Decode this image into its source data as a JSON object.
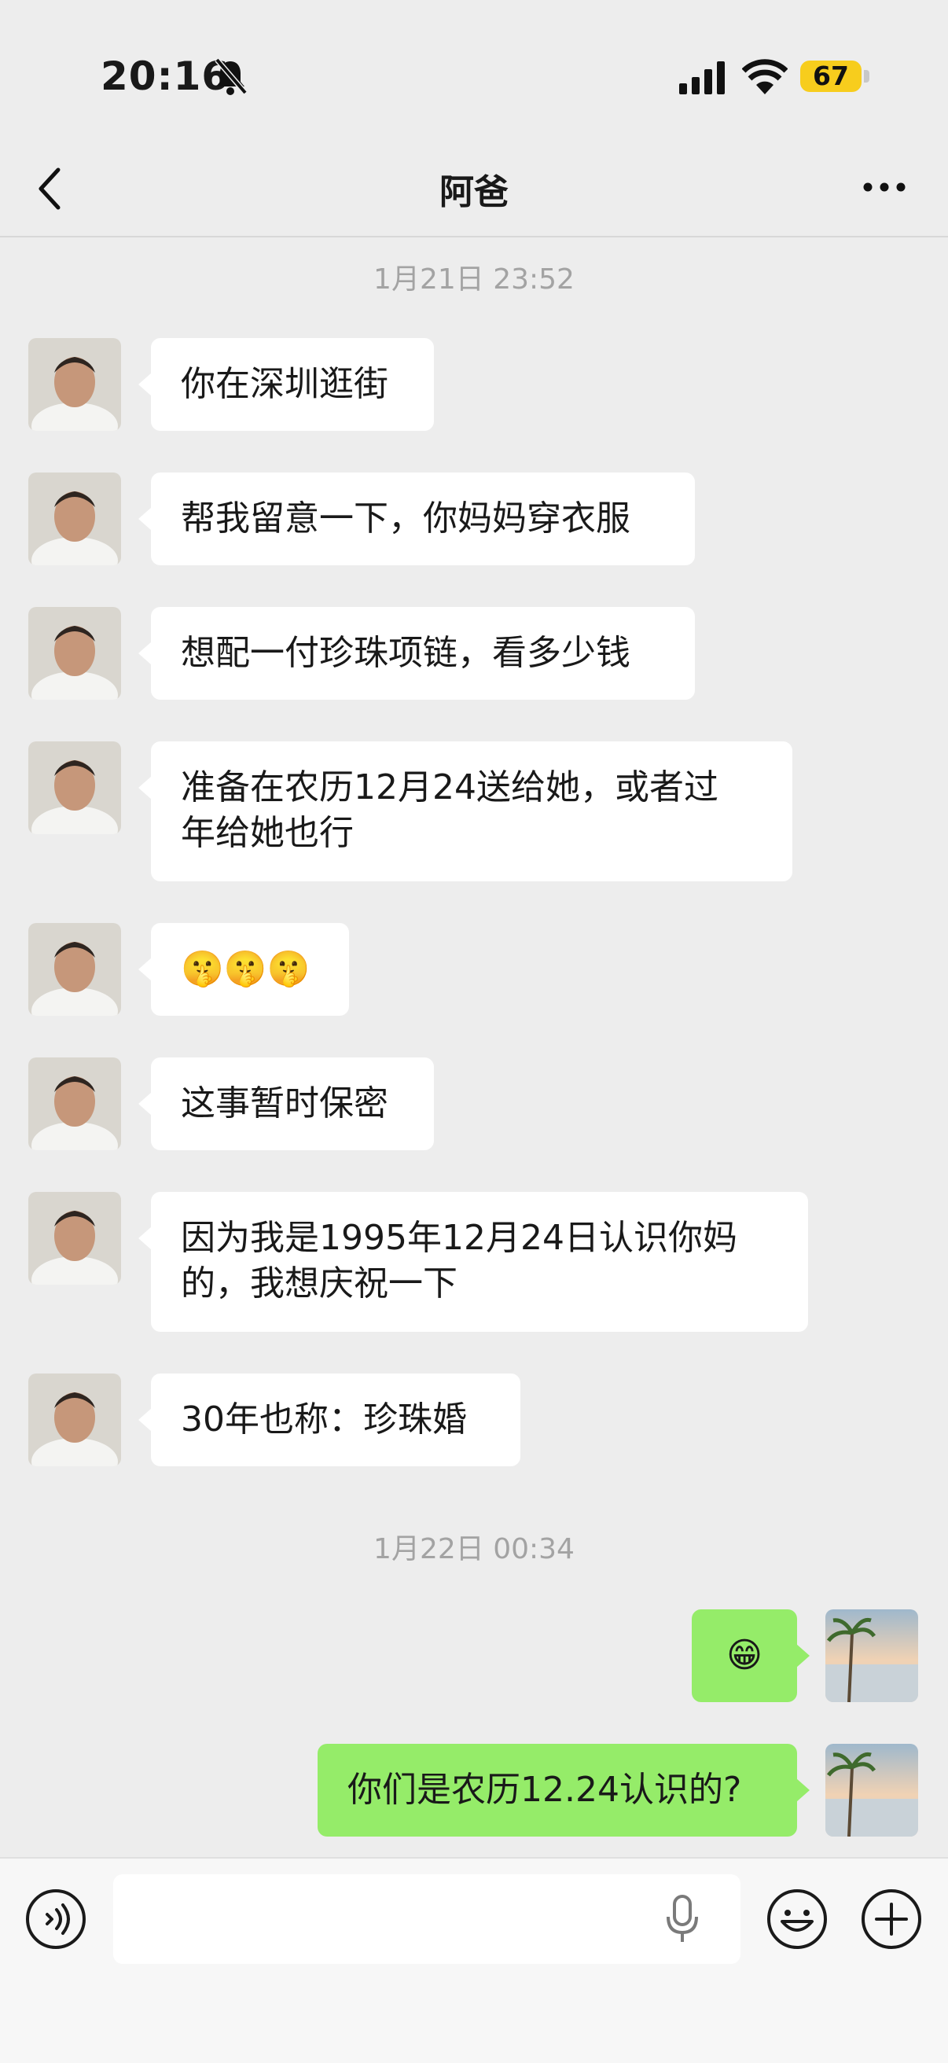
{
  "status_bar": {
    "time": "20:16",
    "battery": "67",
    "icons": [
      "bell-slash-icon",
      "signal-icon",
      "wifi-icon",
      "battery-icon"
    ]
  },
  "nav": {
    "title": "阿爸",
    "back_icon": "chevron-left-icon",
    "more_icon": "more-dots-icon"
  },
  "timestamps": [
    "1月21日 23:52",
    "1月22日 00:34"
  ],
  "messages": [
    {
      "from": "dad",
      "text": "你在深圳逛街"
    },
    {
      "from": "dad",
      "text": "帮我留意一下，你妈妈穿衣服"
    },
    {
      "from": "dad",
      "text": "想配一付珍珠项链，看多少钱"
    },
    {
      "from": "dad",
      "text": "准备在农历12月24送给她，或者过\n年给她也行"
    },
    {
      "from": "dad",
      "text": "🤫🤫🤫"
    },
    {
      "from": "dad",
      "text": "这事暂时保密"
    },
    {
      "from": "dad",
      "text": "因为我是1995年12月24日认识你妈\n的，我想庆祝一下"
    },
    {
      "from": "dad",
      "text": "30年也称：珍珠婚"
    },
    {
      "from": "me",
      "text": "😁"
    },
    {
      "from": "me",
      "text": "你们是农历12.24认识的?"
    }
  ],
  "input_bar": {
    "voice_icon": "voice-mode-icon",
    "mic_icon": "microphone-icon",
    "emoji_icon": "emoji-icon",
    "plus_icon": "plus-circle-icon"
  },
  "colors": {
    "background": "#ededed",
    "outgoing_bubble": "#95ec69",
    "incoming_bubble": "#ffffff",
    "battery": "#f7cd1d"
  }
}
